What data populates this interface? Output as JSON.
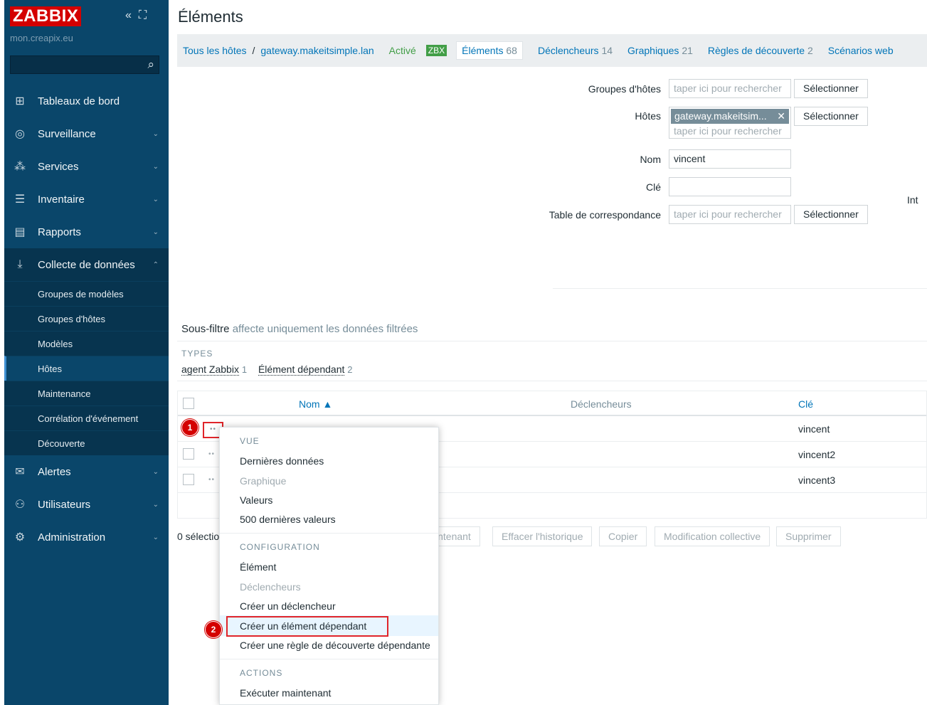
{
  "sidebar": {
    "logo": "ZABBIX",
    "server": "mon.creapix.eu",
    "collapse_icon": "«",
    "kiosk_icon": "⛶",
    "menu": [
      {
        "label": "Tableaux de bord",
        "icon": "dashboard-icon"
      },
      {
        "label": "Surveillance",
        "icon": "eye-icon"
      },
      {
        "label": "Services",
        "icon": "services-icon"
      },
      {
        "label": "Inventaire",
        "icon": "list-icon"
      },
      {
        "label": "Rapports",
        "icon": "report-icon"
      },
      {
        "label": "Collecte de données",
        "icon": "download-icon"
      },
      {
        "label": "Alertes",
        "icon": "envelope-icon"
      },
      {
        "label": "Utilisateurs",
        "icon": "users-icon"
      },
      {
        "label": "Administration",
        "icon": "gear-icon"
      }
    ],
    "submenu": [
      "Groupes de modèles",
      "Groupes d'hôtes",
      "Modèles",
      "Hôtes",
      "Maintenance",
      "Corrélation d'événement",
      "Découverte"
    ]
  },
  "page": {
    "title": "Éléments"
  },
  "breadcrumb": {
    "all_hosts": "Tous les hôtes",
    "sep": "/",
    "host": "gateway.makeitsimple.lan",
    "status": "Activé",
    "zbx": "ZBX",
    "tabs": [
      {
        "label": "Éléments",
        "count": "68"
      },
      {
        "label": "Déclencheurs",
        "count": "14"
      },
      {
        "label": "Graphiques",
        "count": "21"
      },
      {
        "label": "Règles de découverte",
        "count": "2"
      },
      {
        "label": "Scénarios web",
        "count": ""
      }
    ]
  },
  "filter": {
    "host_groups_label": "Groupes d'hôtes",
    "hosts_label": "Hôtes",
    "name_label": "Nom",
    "key_label": "Clé",
    "mapping_label": "Table de correspondance",
    "placeholder": "taper ici pour rechercher",
    "select_btn": "Sélectionner",
    "host_chip": "gateway.makeitsim...",
    "chip_close": "✕",
    "name_value": "vincent",
    "key_value": "",
    "int_label": "Int"
  },
  "subfilter": {
    "title": "Sous-filtre",
    "note": "affecte uniquement les données filtrées",
    "types_header": "TYPES",
    "types": [
      {
        "label": "agent Zabbix",
        "count": "1"
      },
      {
        "label": "Élément dépendant",
        "count": "2"
      }
    ]
  },
  "table": {
    "col_name": "Nom ▲",
    "col_triggers": "Déclencheurs",
    "col_key": "Clé",
    "dots": "••",
    "rows": [
      {
        "key": "vincent"
      },
      {
        "key": "vincent2"
      },
      {
        "key": "vincent3"
      }
    ]
  },
  "footer": {
    "selected": "0 sélectio",
    "buttons": [
      "intenant",
      "Effacer l'historique",
      "Copier",
      "Modification collective",
      "Supprimer"
    ]
  },
  "popup": {
    "view_header": "VUE",
    "view_items": [
      "Dernières données",
      "Graphique",
      "Valeurs",
      "500 dernières valeurs"
    ],
    "config_header": "CONFIGURATION",
    "config_items": [
      "Élément",
      "Déclencheurs",
      "Créer un déclencheur",
      "Créer un élément dépendant",
      "Créer une règle de découverte dépendante"
    ],
    "actions_header": "ACTIONS",
    "actions_items": [
      "Exécuter maintenant"
    ]
  },
  "annotations": {
    "badge1": "1",
    "badge2": "2"
  },
  "colors": {
    "sidebar": "#0a466a",
    "logo": "#d40000",
    "link": "#0275b8",
    "active_green": "#429e47",
    "highlight_red": "#e0252a"
  }
}
